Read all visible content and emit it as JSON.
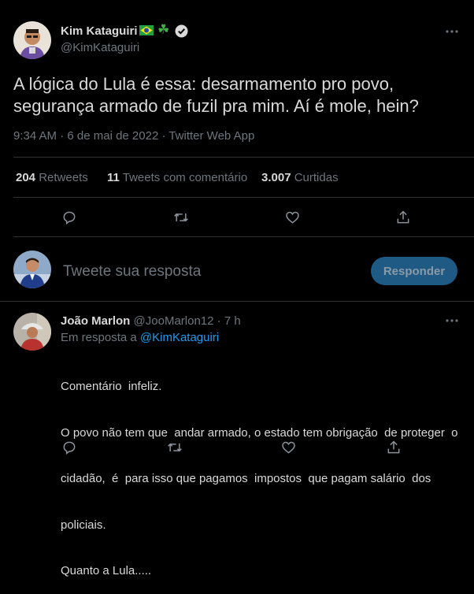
{
  "colors": {
    "background": "#000000",
    "text": "#d9d9d9",
    "muted": "#6e767d",
    "link": "#1d9bf0",
    "divider": "#2f3336",
    "reply_button": "#1f5a84"
  },
  "tweet": {
    "author_name": "Kim Kataguiri",
    "badges": [
      "brazil-flag-icon",
      "shamrock-icon",
      "verified-badge-icon"
    ],
    "shamrock": "☘",
    "handle": "@KimKataguiri",
    "text": "A lógica do Lula é essa: desarmamento pro povo, segurança armado de fuzil pra mim. Aí é mole, hein?",
    "meta": "9:34 AM · 6 de mai de 2022 · Twitter Web App",
    "stats": {
      "retweets_count": "204",
      "retweets_label": "Retweets",
      "quotes_count": "11",
      "quotes_label": "Tweets com comentário",
      "likes_count": "3.007",
      "likes_label": "Curtidas"
    },
    "actions": [
      "reply-icon",
      "retweet-icon",
      "like-icon",
      "share-icon"
    ]
  },
  "compose": {
    "placeholder": "Tweete sua resposta",
    "button_label": "Responder"
  },
  "reply": {
    "author_name": "João Marlon",
    "handle": "@JooMarlon12",
    "separator": "·",
    "time": "7 h",
    "replying_to_prefix": "Em resposta a",
    "replying_to_handle": "@KimKataguiri",
    "lines": [
      "Comentário  infeliz.",
      "O povo não tem que  andar armado, o estado tem obrigação  de proteger  o",
      "cidadão,  é  para isso que pagamos  impostos  que pagam salário  dos",
      "policiais.",
      "Quanto a Lula....."
    ]
  }
}
